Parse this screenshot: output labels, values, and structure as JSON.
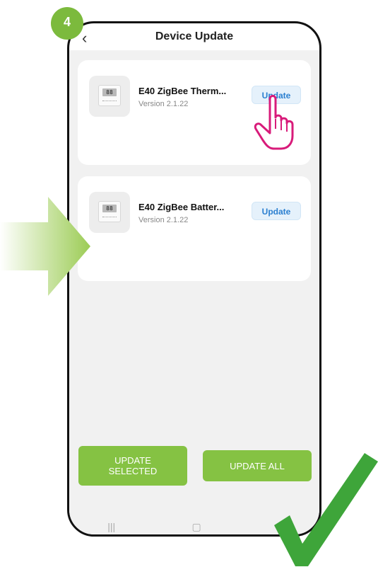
{
  "step": "4",
  "header": {
    "back_icon": "‹",
    "title": "Device Update"
  },
  "devices": [
    {
      "name": "E40 ZigBee Therm...",
      "version": "Version 2.1.22",
      "button": "Update",
      "thumb_text": "88"
    },
    {
      "name": "E40 ZigBee Batter...",
      "version": "Version 2.1.22",
      "button": "Update",
      "thumb_text": "88"
    }
  ],
  "actions": {
    "update_selected": "UPDATE\nSELECTED",
    "update_all": "UPDATE ALL"
  },
  "navbar": {
    "recent": "|||",
    "home": "▢",
    "back": "‹"
  },
  "colors": {
    "accent_green": "#85c243",
    "update_blue": "#2a7fd0",
    "pointer_pink": "#d81b7a",
    "check_green": "#3ea53a"
  },
  "icons": [
    "back-icon",
    "thermostat-icon",
    "hand-pointer-icon",
    "right-arrow-icon",
    "checkmark-icon"
  ]
}
